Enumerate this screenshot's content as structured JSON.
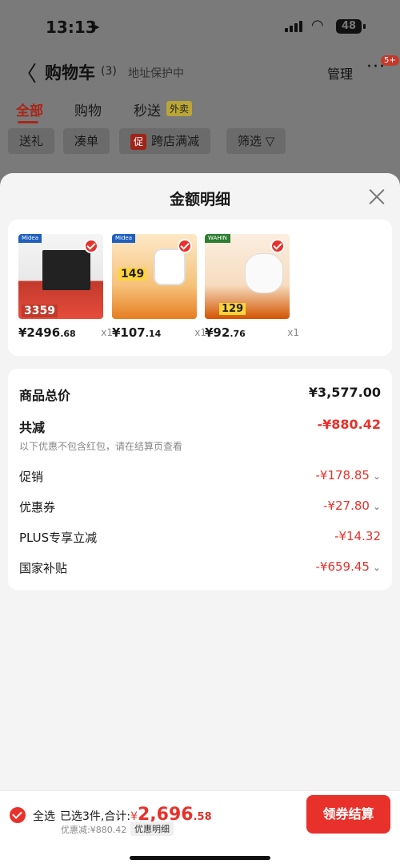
{
  "status_bar": {
    "time": "13:13",
    "battery": "48"
  },
  "nav": {
    "back": "〈",
    "title": "购物车",
    "count": "(3)",
    "address": "地址保护中",
    "manage": "管理",
    "more": "···",
    "badge": "5+"
  },
  "tabs": [
    {
      "label": "全部",
      "active": true
    },
    {
      "label": "购物",
      "active": false
    },
    {
      "label": "秒送",
      "active": false
    }
  ],
  "tabs_tag": "外卖",
  "chips": [
    {
      "label": "送礼"
    },
    {
      "label": "凑单"
    },
    {
      "label": "跨店满减",
      "prefix": "促"
    },
    {
      "label": "筛选"
    }
  ],
  "sheet": {
    "title": "金额明细",
    "products": [
      {
        "price_int": "¥2496",
        "price_dec": ".68",
        "qty": "x1",
        "image_brand": "Midea",
        "image_big": "3359",
        "selected": true,
        "accent": "#c0392b"
      },
      {
        "price_int": "¥107",
        "price_dec": ".14",
        "qty": "x1",
        "image_brand": "Midea",
        "image_big": "149",
        "selected": true,
        "accent": "#e67e22"
      },
      {
        "price_int": "¥92",
        "price_dec": ".76",
        "qty": "x1",
        "image_brand": "WAHIN",
        "image_big": "129",
        "selected": true,
        "accent": "#d35400"
      }
    ],
    "summary": {
      "total_label": "商品总价",
      "total_value": "¥3,577.00",
      "reduce_label": "共减",
      "reduce_value": "-¥880.42",
      "note": "以下优惠不包含红包，请在结算页查看",
      "items": [
        {
          "label": "促销",
          "value": "-¥178.85",
          "expandable": true
        },
        {
          "label": "优惠券",
          "value": "-¥27.80",
          "expandable": true
        },
        {
          "label": "PLUS专享立减",
          "value": "-¥14.32",
          "expandable": false
        },
        {
          "label": "国家补贴",
          "value": "-¥659.45",
          "expandable": true
        }
      ]
    }
  },
  "bottom_bar": {
    "select_all": "全选",
    "selected_text": "已选3件,合计:",
    "currency": "¥",
    "total_int": "2,696",
    "total_dec": ".58",
    "discount": "优惠减:¥880.42",
    "detail_tag": "优惠明细",
    "pay_button": "领券结算"
  },
  "colors": {
    "accent": "#e8312a",
    "sheet_bg": "#f4f4f4",
    "overlay": "#7a7a7a"
  }
}
